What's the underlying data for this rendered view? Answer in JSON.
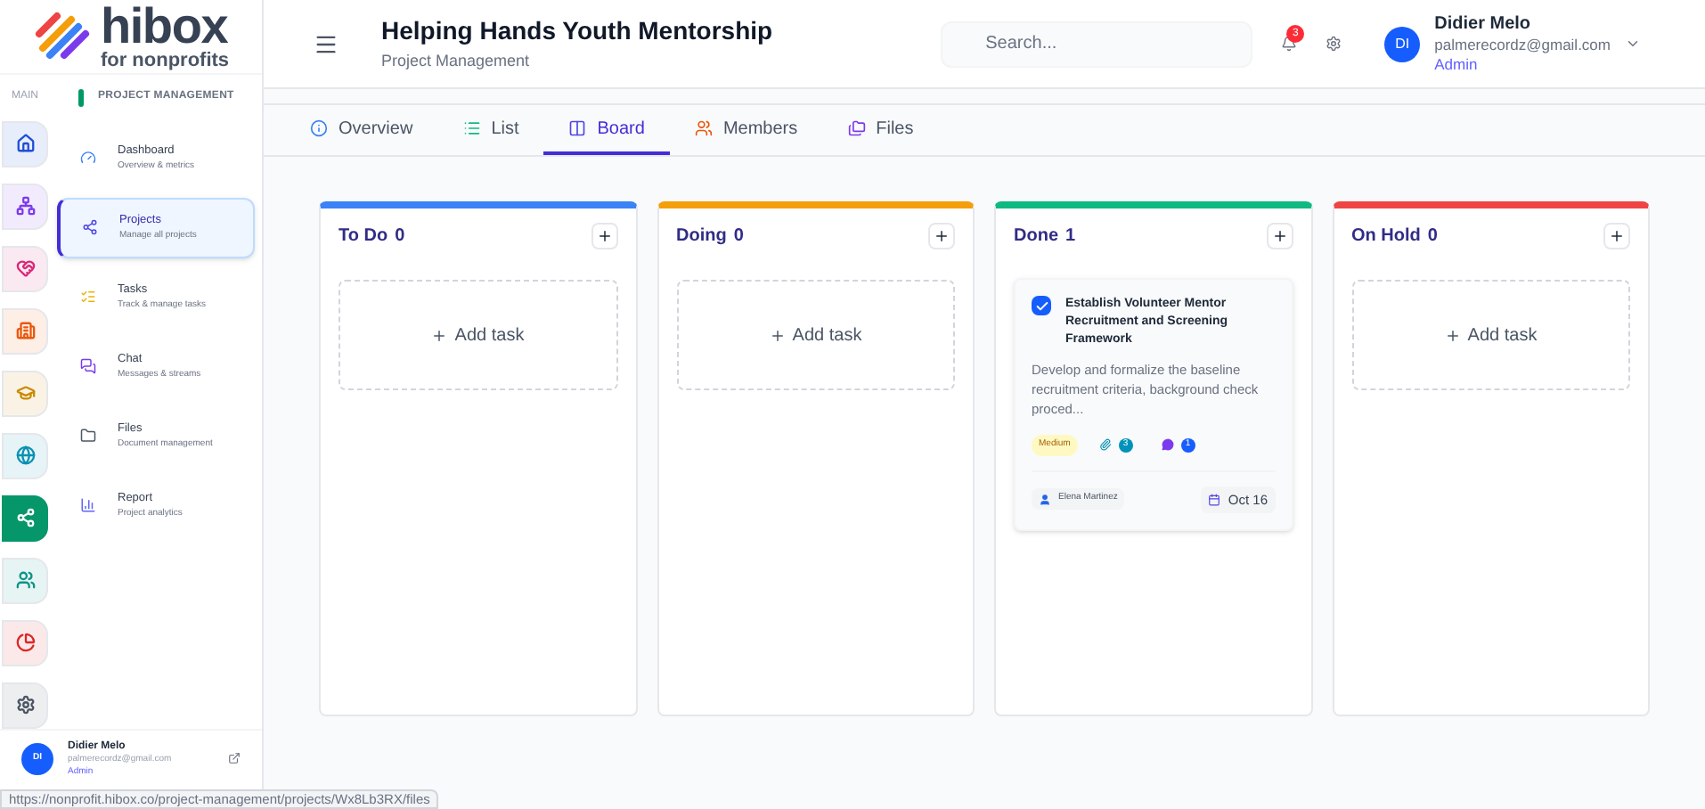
{
  "logo": {
    "name": "hibox",
    "tagline": "for nonprofits"
  },
  "rail": {
    "label": "MAIN",
    "items": [
      {
        "kind": "home",
        "color": "#1d4ed8",
        "selected": false
      },
      {
        "kind": "sitemap",
        "color": "#7c3aed",
        "selected": false
      },
      {
        "kind": "hands",
        "color": "#db2777",
        "selected": false
      },
      {
        "kind": "building",
        "color": "#ea580c",
        "selected": false
      },
      {
        "kind": "cap",
        "color": "#ca8a04",
        "selected": false
      },
      {
        "kind": "globe",
        "color": "#0891b2",
        "selected": false
      },
      {
        "kind": "nodes",
        "color": "#059669",
        "selected": true
      },
      {
        "kind": "people",
        "color": "#0d9488",
        "selected": false
      },
      {
        "kind": "pie",
        "color": "#dc2626",
        "selected": false
      },
      {
        "kind": "gear",
        "color": "#4b5563",
        "selected": false
      }
    ]
  },
  "submenu": {
    "title": "PROJECT MANAGEMENT",
    "items": [
      {
        "kind": "dashboard",
        "label": "Dashboard",
        "sub": "Overview & metrics",
        "selected": false
      },
      {
        "kind": "projects",
        "label": "Projects",
        "sub": "Manage all projects",
        "selected": true
      },
      {
        "kind": "tasks",
        "label": "Tasks",
        "sub": "Track & manage tasks",
        "selected": false
      },
      {
        "kind": "chat",
        "label": "Chat",
        "sub": "Messages & streams",
        "selected": false
      },
      {
        "kind": "files",
        "label": "Files",
        "sub": "Document management",
        "selected": false
      },
      {
        "kind": "report",
        "label": "Report",
        "sub": "Project analytics",
        "selected": false
      }
    ]
  },
  "sidebar_user": {
    "initials": "DI",
    "name": "Didier Melo",
    "email": "palmerecordz@gmail.com",
    "role": "Admin"
  },
  "header": {
    "title": "Helping Hands Youth Mentorship",
    "subtitle": "Project Management",
    "search": {
      "placeholder": "Search..."
    },
    "notifications": "3"
  },
  "user": {
    "initials": "DI",
    "name": "Didier Melo",
    "email": "palmerecordz@gmail.com",
    "role": "Admin"
  },
  "tabs": [
    {
      "kind": "info",
      "label": "Overview",
      "selected": false
    },
    {
      "kind": "list",
      "label": "List",
      "selected": false
    },
    {
      "kind": "board",
      "label": "Board",
      "selected": true
    },
    {
      "kind": "members",
      "label": "Members",
      "selected": false
    },
    {
      "kind": "files",
      "label": "Files",
      "selected": false
    }
  ],
  "columns": [
    {
      "title": "To Do",
      "count": "0",
      "color": "#3b82f6",
      "add_label": "Add task"
    },
    {
      "title": "Doing",
      "count": "0",
      "color": "#f59e0b",
      "add_label": "Add task"
    },
    {
      "title": "Done",
      "count": "1",
      "color": "#10b981",
      "tasks": [
        {
          "title": "Establish Volunteer Mentor Recruitment and Screening Framework",
          "checked": true,
          "description": "Develop and formalize the baseline recruitment criteria, background check proced...",
          "priority": "Medium",
          "attachments": "3",
          "comments": "1",
          "assignee": "Elena Martinez",
          "due": "Oct 16"
        }
      ]
    },
    {
      "title": "On Hold",
      "count": "0",
      "color": "#ef4444",
      "add_label": "Add task"
    }
  ],
  "status_url": "https://nonprofit.hibox.co/project-management/projects/Wx8Lb3RX/files"
}
